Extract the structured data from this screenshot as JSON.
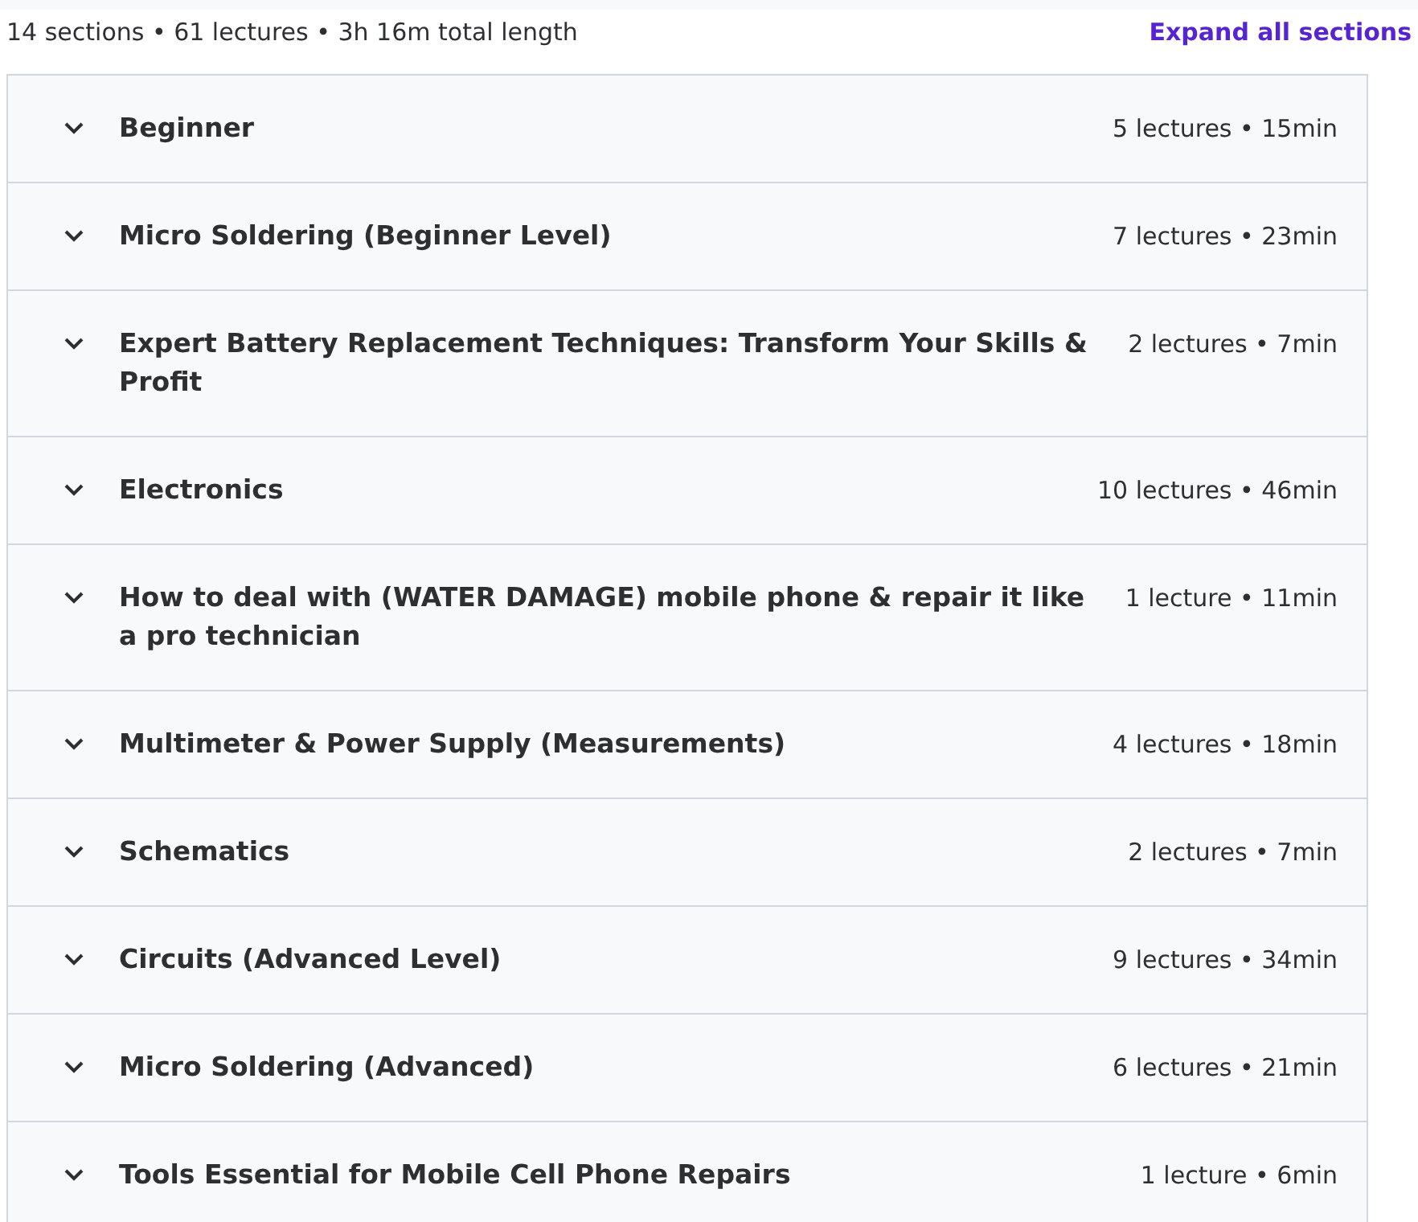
{
  "summary": "14 sections • 61 lectures • 3h 16m total length",
  "expand_all": "Expand all sections",
  "sections": [
    {
      "title": "Beginner",
      "meta": "5 lectures • 15min",
      "expanded": false
    },
    {
      "title": "Micro Soldering (Beginner Level)",
      "meta": "7 lectures • 23min",
      "expanded": false
    },
    {
      "title": "Expert Battery Replacement Techniques: Transform Your Skills & Profit",
      "meta": "2 lectures • 7min",
      "expanded": false
    },
    {
      "title": "Electronics",
      "meta": "10 lectures • 46min",
      "expanded": false
    },
    {
      "title": "How to deal with (WATER DAMAGE) mobile phone & repair it like a pro technician",
      "meta": "1 lecture • 11min",
      "expanded": false
    },
    {
      "title": "Multimeter & Power Supply (Measurements)",
      "meta": "4 lectures • 18min",
      "expanded": false
    },
    {
      "title": "Schematics",
      "meta": "2 lectures • 7min",
      "expanded": false
    },
    {
      "title": "Circuits (Advanced Level)",
      "meta": "9 lectures • 34min",
      "expanded": false
    },
    {
      "title": "Micro Soldering (Advanced)",
      "meta": "6 lectures • 21min",
      "expanded": false
    },
    {
      "title": "Tools Essential for Mobile Cell Phone Repairs",
      "meta": "1 lecture • 6min",
      "expanded": false
    }
  ]
}
